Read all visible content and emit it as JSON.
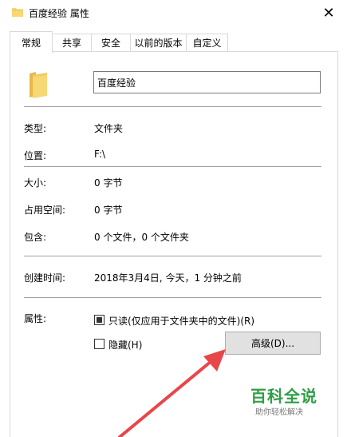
{
  "window": {
    "title": "百度经验 属性",
    "close_glyph": "✕"
  },
  "tabs": [
    {
      "label": "常规",
      "active": true
    },
    {
      "label": "共享",
      "active": false
    },
    {
      "label": "安全",
      "active": false
    },
    {
      "label": "以前的版本",
      "active": false
    },
    {
      "label": "自定义",
      "active": false
    }
  ],
  "general": {
    "name_value": "百度经验",
    "type": {
      "label": "类型:",
      "value": "文件夹"
    },
    "location": {
      "label": "位置:",
      "value": "F:\\"
    },
    "size": {
      "label": "大小:",
      "value": "0 字节"
    },
    "size_on_disk": {
      "label": "占用空间:",
      "value": "0 字节"
    },
    "contains": {
      "label": "包含:",
      "value": "0 个文件，0 个文件夹"
    },
    "created": {
      "label": "创建时间:",
      "value": "2018年3月4日, 今天，1 分钟之前"
    },
    "attributes": {
      "label": "属性:",
      "readonly": {
        "label": "只读(仅应用于文件夹中的文件)(R)",
        "checked": true
      },
      "hidden": {
        "label": "隐藏(H)",
        "checked": false
      },
      "advanced_button": "高级(D)..."
    }
  },
  "watermark": {
    "title": "百科全说",
    "subtitle": "助你轻松解决"
  },
  "colors": {
    "folder": "#f8d775",
    "arrow": "#e8474a",
    "watermark_green": "#2f9e46"
  }
}
